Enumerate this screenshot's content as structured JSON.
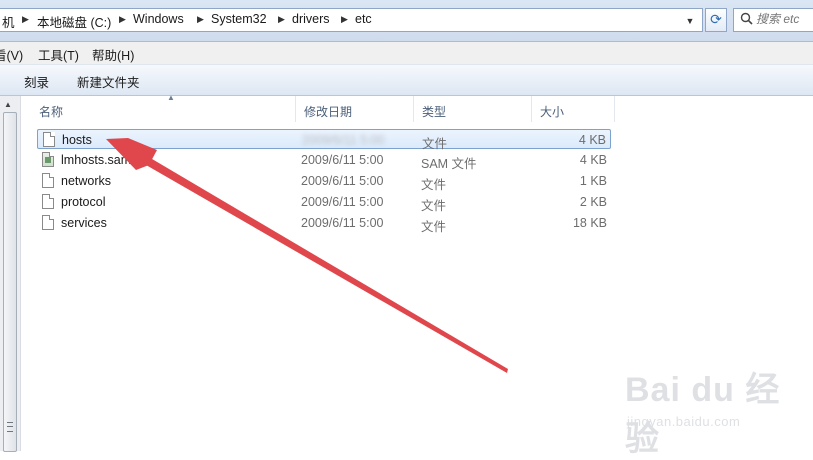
{
  "address": {
    "crumbs": [
      "机",
      "本地磁盘 (C:)",
      "Windows",
      "System32",
      "drivers",
      "etc"
    ],
    "dropdown": "▼",
    "refresh_glyph": "⟳"
  },
  "search": {
    "placeholder": "搜索 etc",
    "icon": "search-icon"
  },
  "menubar": {
    "items": [
      "看(V)",
      "工具(T)",
      "帮助(H)"
    ]
  },
  "commands": {
    "items": [
      "刻录",
      "新建文件夹"
    ]
  },
  "list": {
    "columns": [
      "名称",
      "修改日期",
      "类型",
      "大小"
    ],
    "files": [
      {
        "name": "hosts",
        "date": "2009/6/11 5:00",
        "type": "文件",
        "size": "4 KB",
        "icon": "file-icon"
      },
      {
        "name": "lmhosts.sam",
        "date": "2009/6/11 5:00",
        "type": "SAM 文件",
        "size": "4 KB",
        "icon": "sam-file-icon"
      },
      {
        "name": "networks",
        "date": "2009/6/11 5:00",
        "type": "文件",
        "size": "1 KB",
        "icon": "file-icon"
      },
      {
        "name": "protocol",
        "date": "2009/6/11 5:00",
        "type": "文件",
        "size": "2 KB",
        "icon": "file-icon"
      },
      {
        "name": "services",
        "date": "2009/6/11 5:00",
        "type": "文件",
        "size": "18 KB",
        "icon": "file-icon"
      }
    ],
    "selected_index": 0
  },
  "annotation": {
    "arrow_color": "#e0474c"
  },
  "watermark": {
    "logo": "Bai du 经验",
    "url": "jingyan.baidu.com"
  }
}
